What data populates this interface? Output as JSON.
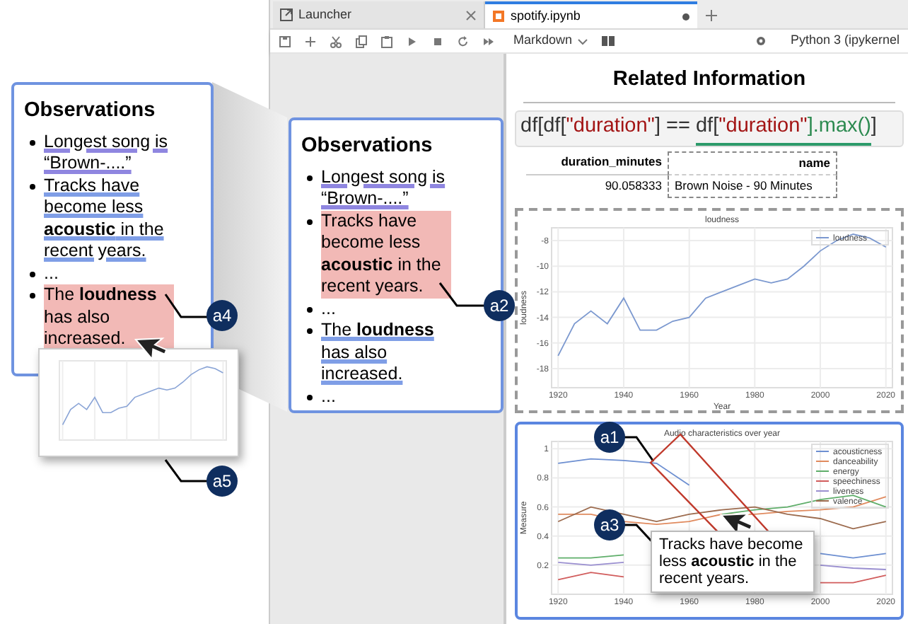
{
  "zoomed_observations": {
    "title": "Observations",
    "items": [
      {
        "text": "Longest song is “Brown-....”",
        "kind": "underlined",
        "color": "#8f86e0"
      },
      {
        "text": "Tracks have become less **acoustic** in the recent years.",
        "kind": "underlined",
        "color": "#7f9ee6"
      },
      {
        "text": "...",
        "kind": "plain"
      },
      {
        "text": "The **loudness** has also increased.",
        "kind": "highlighted"
      }
    ]
  },
  "tabs": [
    {
      "label": "Launcher",
      "selected": false
    },
    {
      "label": "spotify.ipynb",
      "selected": true
    }
  ],
  "toolbar": {
    "cell_type": "Markdown",
    "kernel": "Python 3 (ipykernel"
  },
  "observations": {
    "title": "Observations",
    "items": [
      {
        "text": "Longest song is “Brown-....”",
        "kind": "underlined",
        "color": "#8f86e0"
      },
      {
        "text": "Tracks have become less **acoustic** in the recent years.",
        "kind": "highlighted"
      },
      {
        "text": "...",
        "kind": "plain"
      },
      {
        "text": "The **loudness** has also increased.",
        "kind": "underlined",
        "color": "#7f9ee6"
      },
      {
        "text": "...",
        "kind": "plain"
      }
    ]
  },
  "related_information": {
    "title": "Related Information",
    "code": [
      {
        "text": "df[df[",
        "kind": "plain",
        "underlined": false
      },
      {
        "text": "\"duration\"",
        "kind": "string",
        "underlined": false
      },
      {
        "text": "] == ",
        "kind": "plain",
        "underlined": false
      },
      {
        "text": "df[",
        "kind": "plain",
        "underlined": true
      },
      {
        "text": "\"duration\"",
        "kind": "string",
        "underlined": true
      },
      {
        "text": "].max()",
        "kind": "method",
        "underlined": true
      },
      {
        "text": "]",
        "kind": "plain",
        "underlined": false
      }
    ],
    "table": {
      "columns": [
        "duration_minutes",
        "name"
      ],
      "rows": [
        [
          "90.058333",
          "Brown Noise - 90 Minutes"
        ]
      ]
    },
    "charts": [
      {
        "chart_data": {
          "type": "line",
          "title": "loudness",
          "xlabel": "Year",
          "ylabel": "loudness",
          "x": [
            1920,
            1925,
            1930,
            1935,
            1940,
            1945,
            1950,
            1955,
            1960,
            1965,
            1970,
            1975,
            1980,
            1985,
            1990,
            1995,
            2000,
            2005,
            2010,
            2015,
            2020
          ],
          "series": [
            {
              "name": "loudness",
              "color": "#7b98cf",
              "values": [
                -17,
                -14.5,
                -13.5,
                -14.5,
                -12.5,
                -15,
                -15,
                -14.3,
                -14,
                -12.5,
                -12,
                -11.5,
                -11,
                -11.3,
                -11,
                -10,
                -8.8,
                -8,
                -7.5,
                -7.8,
                -8.5
              ]
            }
          ],
          "xlim": [
            1918,
            2022
          ],
          "ylim": [
            -19.5,
            -7
          ],
          "xticks": [
            1920,
            1940,
            1960,
            1980,
            2000,
            2020
          ],
          "yticks": [
            -18,
            -16,
            -14,
            -12,
            -10,
            -8
          ],
          "grid": true,
          "legend": true
        }
      },
      {
        "chart_data": {
          "type": "line",
          "title": "Audio characteristics over year",
          "ylabel": "Measure",
          "x": [
            1920,
            1930,
            1940,
            1950,
            1960,
            1970,
            1980,
            1990,
            2000,
            2010,
            2020
          ],
          "series": [
            {
              "name": "acousticness",
              "color": "#6d8fd1",
              "values": [
                0.9,
                0.93,
                0.92,
                0.9,
                0.75,
                null,
                null,
                null,
                0.28,
                0.25,
                0.28
              ]
            },
            {
              "name": "danceability",
              "color": "#e08a5e",
              "values": [
                0.55,
                0.55,
                0.5,
                0.48,
                0.5,
                0.55,
                0.55,
                0.57,
                0.58,
                0.6,
                0.67
              ]
            },
            {
              "name": "energy",
              "color": "#5fae6a",
              "values": [
                0.25,
                0.25,
                0.27,
                null,
                null,
                0.55,
                0.58,
                0.6,
                0.65,
                0.68,
                0.6
              ]
            },
            {
              "name": "speechiness",
              "color": "#d15c5c",
              "values": [
                0.1,
                0.15,
                0.12,
                null,
                null,
                null,
                null,
                null,
                0.08,
                0.08,
                0.13
              ]
            },
            {
              "name": "liveness",
              "color": "#9a8fd0",
              "values": [
                0.22,
                0.2,
                0.22,
                null,
                null,
                null,
                null,
                null,
                0.2,
                0.18,
                0.17
              ]
            },
            {
              "name": "valence",
              "color": "#9c6b4e",
              "values": [
                0.5,
                0.6,
                0.55,
                0.5,
                0.55,
                0.58,
                0.6,
                0.55,
                0.52,
                0.45,
                0.5
              ]
            }
          ],
          "xlim": [
            1918,
            2022
          ],
          "ylim": [
            0,
            1.05
          ],
          "xticks": [
            1920,
            1940,
            1960,
            1980,
            2000,
            2020
          ],
          "yticks": [
            0.2,
            0.4,
            0.6,
            0.8,
            1.0
          ],
          "grid": true,
          "legend": true
        }
      }
    ]
  },
  "annotations": {
    "badges": [
      {
        "label": "a1"
      },
      {
        "label": "a2"
      },
      {
        "label": "a3"
      },
      {
        "label": "a4"
      },
      {
        "label": "a5"
      }
    ],
    "callout": {
      "text": "Tracks have become less **acoustic** in the recent years."
    }
  }
}
